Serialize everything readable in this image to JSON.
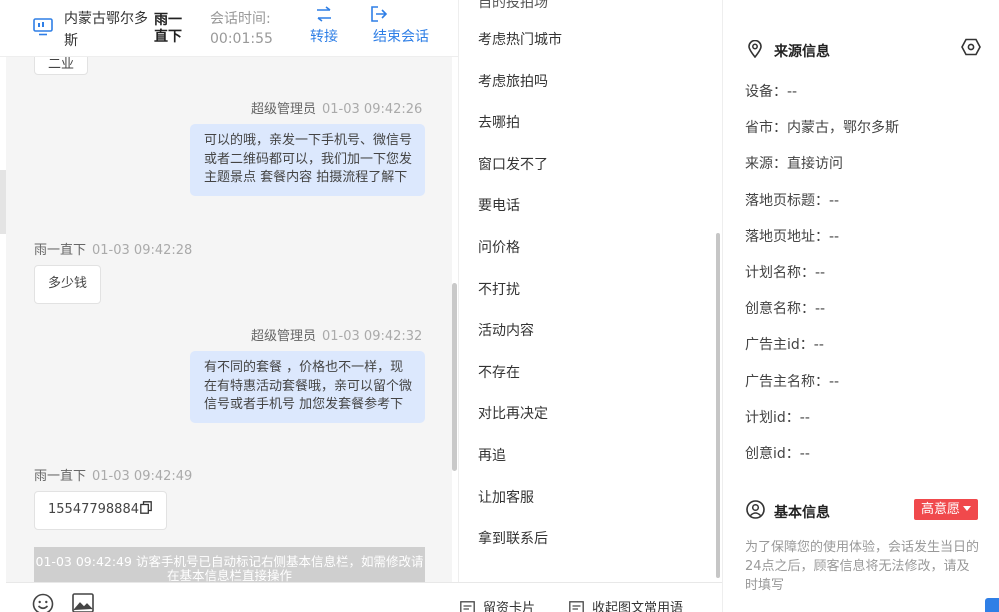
{
  "header": {
    "location": "内蒙古鄂尔多斯",
    "visitor_name": "雨一直下",
    "session_time_label": "会话时间:",
    "session_time": "00:01:55",
    "transfer_label": "转接",
    "end_session_label": "结束会话"
  },
  "chat": {
    "top_partial_reply": "二业",
    "messages": [
      {
        "sender": "超级管理员",
        "time": "01-03 09:42:26",
        "text": "可以的哦，亲发一下手机号、微信号或者二维码都可以，我们加一下您发主题景点 套餐内容 拍摄流程了解下"
      },
      {
        "sender": "雨一直下",
        "time": "01-03 09:42:28",
        "text": "多少钱"
      },
      {
        "sender": "超级管理员",
        "time": "01-03 09:42:32",
        "text": "有不同的套餐 ，价格也不一样，现在有特惠活动套餐哦，亲可以留个微信号或者手机号 加您发套餐参考下"
      },
      {
        "sender": "雨一直下",
        "time": "01-03 09:42:49",
        "text": "15547798884"
      }
    ],
    "system_notice": "01-03 09:42:49 访客手机号已自动标记右侧基本信息栏，如需修改请在基本信息栏直接操作"
  },
  "toolbar": {
    "emoji_icon": "emoji-icon",
    "image_icon": "image-icon",
    "card_label": "留资卡片",
    "collapse_label": "收起图文常用语"
  },
  "quick_replies": {
    "partial_top": "自的投拍场",
    "items": [
      "考虑热门城市",
      "考虑旅拍吗",
      "去哪拍",
      "窗口发不了",
      "要电话",
      "问价格",
      "不打扰",
      "活动内容",
      "不存在",
      "对比再决定",
      "再追",
      "让加客服",
      "拿到联系后"
    ]
  },
  "info_panel": {
    "source_title": "来源信息",
    "fields": [
      {
        "label": "设备",
        "value": "--"
      },
      {
        "label": "省市",
        "value": "内蒙古，鄂尔多斯"
      },
      {
        "label": "来源",
        "value": "直接访问"
      },
      {
        "label": "落地页标题",
        "value": "--"
      },
      {
        "label": "落地页地址",
        "value": "--"
      },
      {
        "label": "计划名称",
        "value": "--"
      },
      {
        "label": "创意名称",
        "value": "--"
      },
      {
        "label": "广告主id",
        "value": "--"
      },
      {
        "label": "广告主名称",
        "value": "--"
      },
      {
        "label": "计划id",
        "value": "--"
      },
      {
        "label": "创意id",
        "value": "--"
      }
    ],
    "basic_title": "基本信息",
    "intent_badge": "高意愿",
    "notice": "为了保障您的使用体验，会话发生当日的24点之后，顾客信息将无法修改，请及时填写"
  },
  "colors": {
    "accent": "#2f7fe6",
    "agent_bubble": "#dce8fd",
    "badge_red": "#f0494c",
    "chat_bg": "#f5f5f5"
  }
}
